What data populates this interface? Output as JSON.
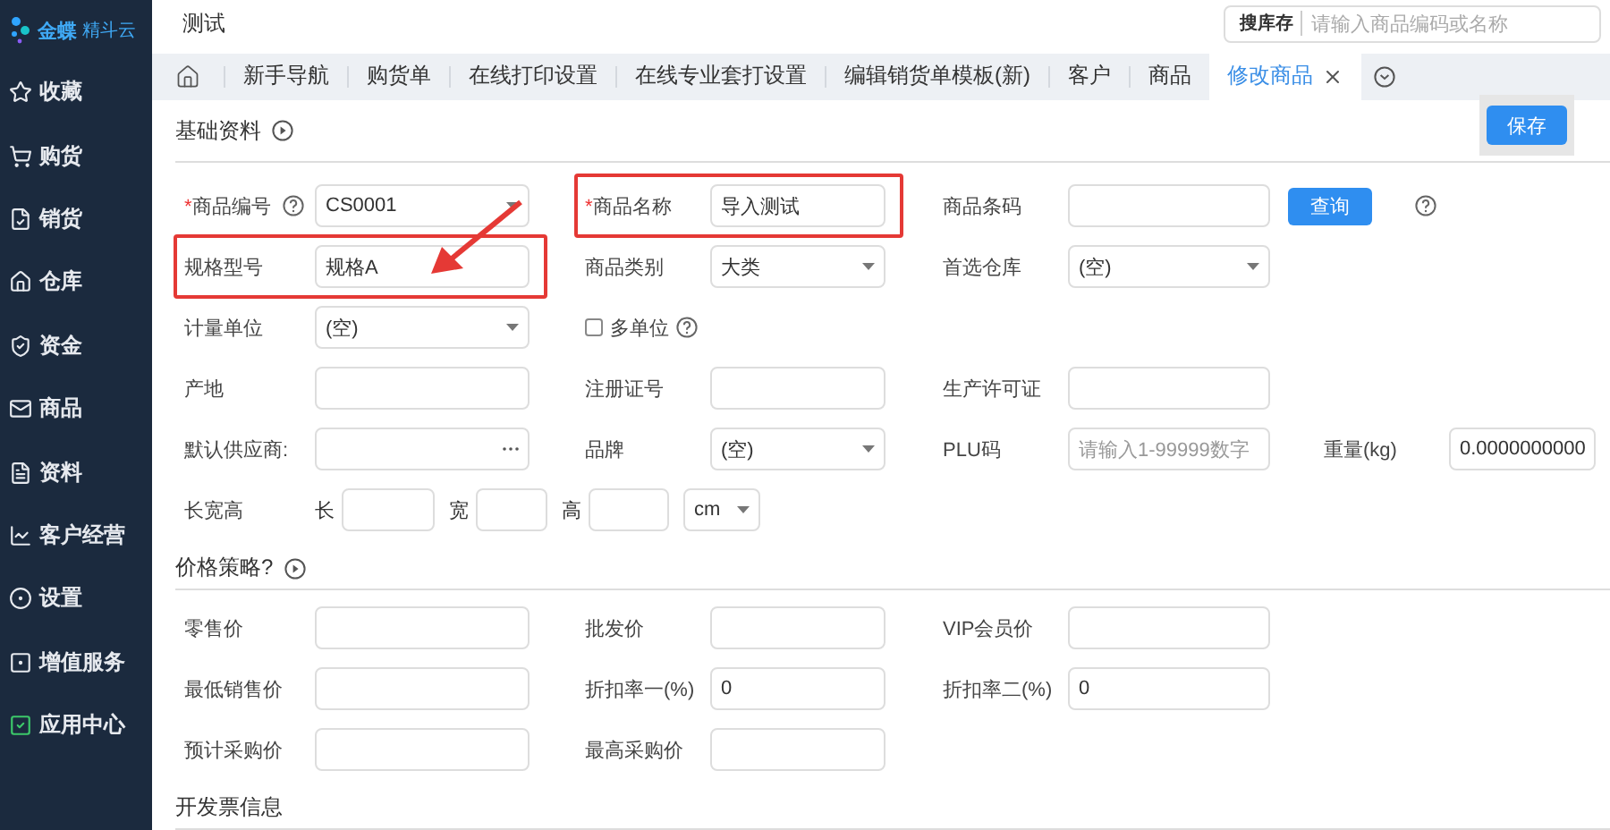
{
  "sidebar": {
    "logo": {
      "brand": "金蝶",
      "product": "精斗云"
    },
    "items": [
      {
        "label": "收藏",
        "selected": false
      },
      {
        "label": "购货",
        "selected": false
      },
      {
        "label": "销货",
        "selected": false
      },
      {
        "label": "仓库",
        "selected": false
      },
      {
        "label": "资金",
        "selected": false
      },
      {
        "label": "商品",
        "selected": false
      },
      {
        "label": "资料",
        "selected": false
      },
      {
        "label": "客户经营",
        "selected": false
      },
      {
        "label": "设置",
        "selected": false
      },
      {
        "label": "增值服务",
        "selected": false
      },
      {
        "label": "应用中心",
        "selected": false
      }
    ]
  },
  "header": {
    "title": "测试",
    "search": {
      "label": "搜库存",
      "placeholder": "请输入商品编码或名称"
    }
  },
  "tabs": [
    {
      "label": "新手导航",
      "selected": false,
      "closable": false
    },
    {
      "label": "购货单",
      "selected": false,
      "closable": false
    },
    {
      "label": "在线打印设置",
      "selected": false,
      "closable": false
    },
    {
      "label": "在线专业套打设置",
      "selected": false,
      "closable": false
    },
    {
      "label": "编辑销货单模板(新)",
      "selected": false,
      "closable": false
    },
    {
      "label": "客户",
      "selected": false,
      "closable": false
    },
    {
      "label": "商品",
      "selected": false,
      "closable": false
    },
    {
      "label": "修改商品",
      "selected": true,
      "closable": true
    }
  ],
  "save_button": "保存",
  "sections": [
    {
      "title": "基础资料",
      "toggle": true,
      "rows": [
        [
          {
            "kind": "select",
            "label": "商品编号",
            "marker": "*",
            "help": true,
            "highlighted": false,
            "value": "CS0001"
          },
          {
            "kind": "input",
            "label": "商品名称",
            "marker": "*",
            "help": false,
            "highlighted": true,
            "value": "导入测试"
          },
          {
            "kind": "input",
            "label": "商品条码",
            "help": true,
            "highlighted": false,
            "button": "查询"
          }
        ],
        [
          {
            "kind": "input",
            "label": "规格型号",
            "help": false,
            "highlighted": true,
            "value": "规格A"
          },
          {
            "kind": "select",
            "label": "商品类别",
            "help": false,
            "highlighted": false,
            "value": "大类"
          },
          {
            "kind": "select",
            "label": "首选仓库",
            "help": false,
            "highlighted": false,
            "value": "(空)"
          }
        ],
        [
          {
            "kind": "select",
            "label": "计量单位",
            "help": false,
            "highlighted": false,
            "value": "(空)"
          },
          {
            "kind": "checkbox",
            "label": "多单位",
            "help": true,
            "highlighted": false,
            "checked": false
          }
        ],
        [
          {
            "kind": "input",
            "label": "产地",
            "help": false,
            "highlighted": false
          },
          {
            "kind": "input",
            "label": "注册证号",
            "help": false,
            "highlighted": false
          },
          {
            "kind": "input",
            "label": "生产许可证",
            "help": false,
            "highlighted": false
          }
        ],
        [
          {
            "kind": "lookup",
            "label": "默认供应商:",
            "help": false,
            "highlighted": false
          },
          {
            "kind": "select",
            "label": "品牌",
            "help": false,
            "highlighted": false,
            "value": "(空)"
          },
          {
            "kind": "input",
            "label": "PLU码",
            "help": false,
            "highlighted": false,
            "placeholder": "请输入1-99999数字"
          },
          {
            "kind": "input",
            "label": "重量(kg)",
            "help": false,
            "highlighted": false,
            "value": "0.0000000000"
          }
        ],
        [
          {
            "kind": "dims",
            "label": "长宽高",
            "help": false,
            "highlighted": false,
            "parts": [
              "长",
              "宽",
              "高"
            ],
            "unit": "cm"
          }
        ]
      ]
    },
    {
      "title": "价格策略?",
      "toggle": true,
      "rows": [
        [
          {
            "kind": "input",
            "label": "零售价",
            "help": false,
            "highlighted": false
          },
          {
            "kind": "input",
            "label": "批发价",
            "help": false,
            "highlighted": false
          },
          {
            "kind": "input",
            "label": "VIP会员价",
            "help": false,
            "highlighted": false
          }
        ],
        [
          {
            "kind": "input",
            "label": "最低销售价",
            "help": false,
            "highlighted": false
          },
          {
            "kind": "input",
            "label": "折扣率一(%)",
            "help": false,
            "highlighted": false,
            "value": "0"
          },
          {
            "kind": "input",
            "label": "折扣率二(%)",
            "help": false,
            "highlighted": false,
            "value": "0"
          }
        ],
        [
          {
            "kind": "input",
            "label": "预计采购价",
            "help": false,
            "highlighted": false
          },
          {
            "kind": "input",
            "label": "最高采购价",
            "help": false,
            "highlighted": false
          }
        ]
      ]
    },
    {
      "title": "开发票信息",
      "toggle": false
    }
  ]
}
